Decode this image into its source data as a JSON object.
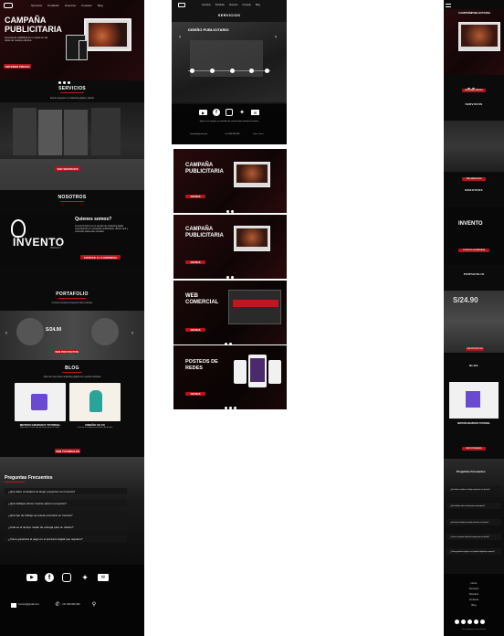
{
  "brand": {
    "logo_text": "INVENTO",
    "logo_sub": "PRODUCT"
  },
  "nav": {
    "items": [
      "Servicios",
      "Portafolio",
      "Nosotros",
      "Contacto",
      "Blog"
    ]
  },
  "hero": {
    "title_line1": "CAMPAÑA",
    "title_line2": "PUBLICITARIA",
    "subtitle": "Aumenta la visibilidad de tu marca en las redes de manera efectiva",
    "button": "Obtener precio"
  },
  "services": {
    "title": "SERVICIOS",
    "subtitle": "Somos expertos en marketing digital y diseño",
    "button": "Ver servicios"
  },
  "about": {
    "title": "NOSOTROS",
    "heading": "Quienes somos?",
    "body": "Invento Product es un estudio de marketing digital especializado en campañas publicitarias, diseño web y contenido para redes sociales.",
    "button": "Conoce a la empresa"
  },
  "portfolio": {
    "title": "PORTAFOLIO",
    "subtitle": "Conoce nuestros proyectos mas recientes",
    "button": "Ver proyectos",
    "price": "S/24.90"
  },
  "blog": {
    "title": "BLOG",
    "subtitle": "Aprende mas sobre marketing digital con nuestros articulos",
    "cards": [
      {
        "title": "MOTION GRAPHICS TUTORIAL",
        "text": "Aprende a crear animaciones para tus redes"
      },
      {
        "title": "DISEÑO UX /UI",
        "text": "Conoce las mejores practicas de diseño"
      }
    ],
    "button": "Ver tutoriales"
  },
  "faq": {
    "title": "Preguntas Frecuentes",
    "items": [
      "¿Qué debo considerar al elegir proyectos con Invento?",
      "¿Qué trabajos ofrece Invento para mi proyecto?",
      "¿Qué tipo de trabajo se puede encontrar en Invento?",
      "¿Cual es el tiempo medio de entrega para un diseño?",
      "¿Cómo garantiza el pago en el producto digital que requiere?"
    ]
  },
  "footer": {
    "email": "invento@gmail.com",
    "phone": "+51 999 999 999",
    "location": "Lima - Peru",
    "tagline": "Sigue a tus amigos y conocidos de nuestra linea mientras inviertes",
    "links": [
      "Home",
      "Servicios",
      "Nosotros",
      "Contacto",
      "Blog"
    ],
    "copyright": "Desarrollado por Invento Product"
  },
  "slides": [
    {
      "title_line1": "CAMPAÑA",
      "title_line2": "PUBLICITARIA",
      "button": "Ver mas"
    },
    {
      "title_line1": "CAMPAÑA",
      "title_line2": "PUBLICITARIA",
      "button": "Ver mas"
    },
    {
      "title_line1": "WEB",
      "title_line2": "COMERCIAL",
      "button": "Ver mas"
    },
    {
      "title_line1": "POSTEOS DE",
      "title_line2": "REDES",
      "button": "Ver mas"
    }
  ],
  "services_slider": {
    "title": "SERVICIOS",
    "item_title": "DISEÑO PUBLICITARIO"
  },
  "colors": {
    "accent": "#c0161f",
    "bg": "#0b0b0b"
  }
}
